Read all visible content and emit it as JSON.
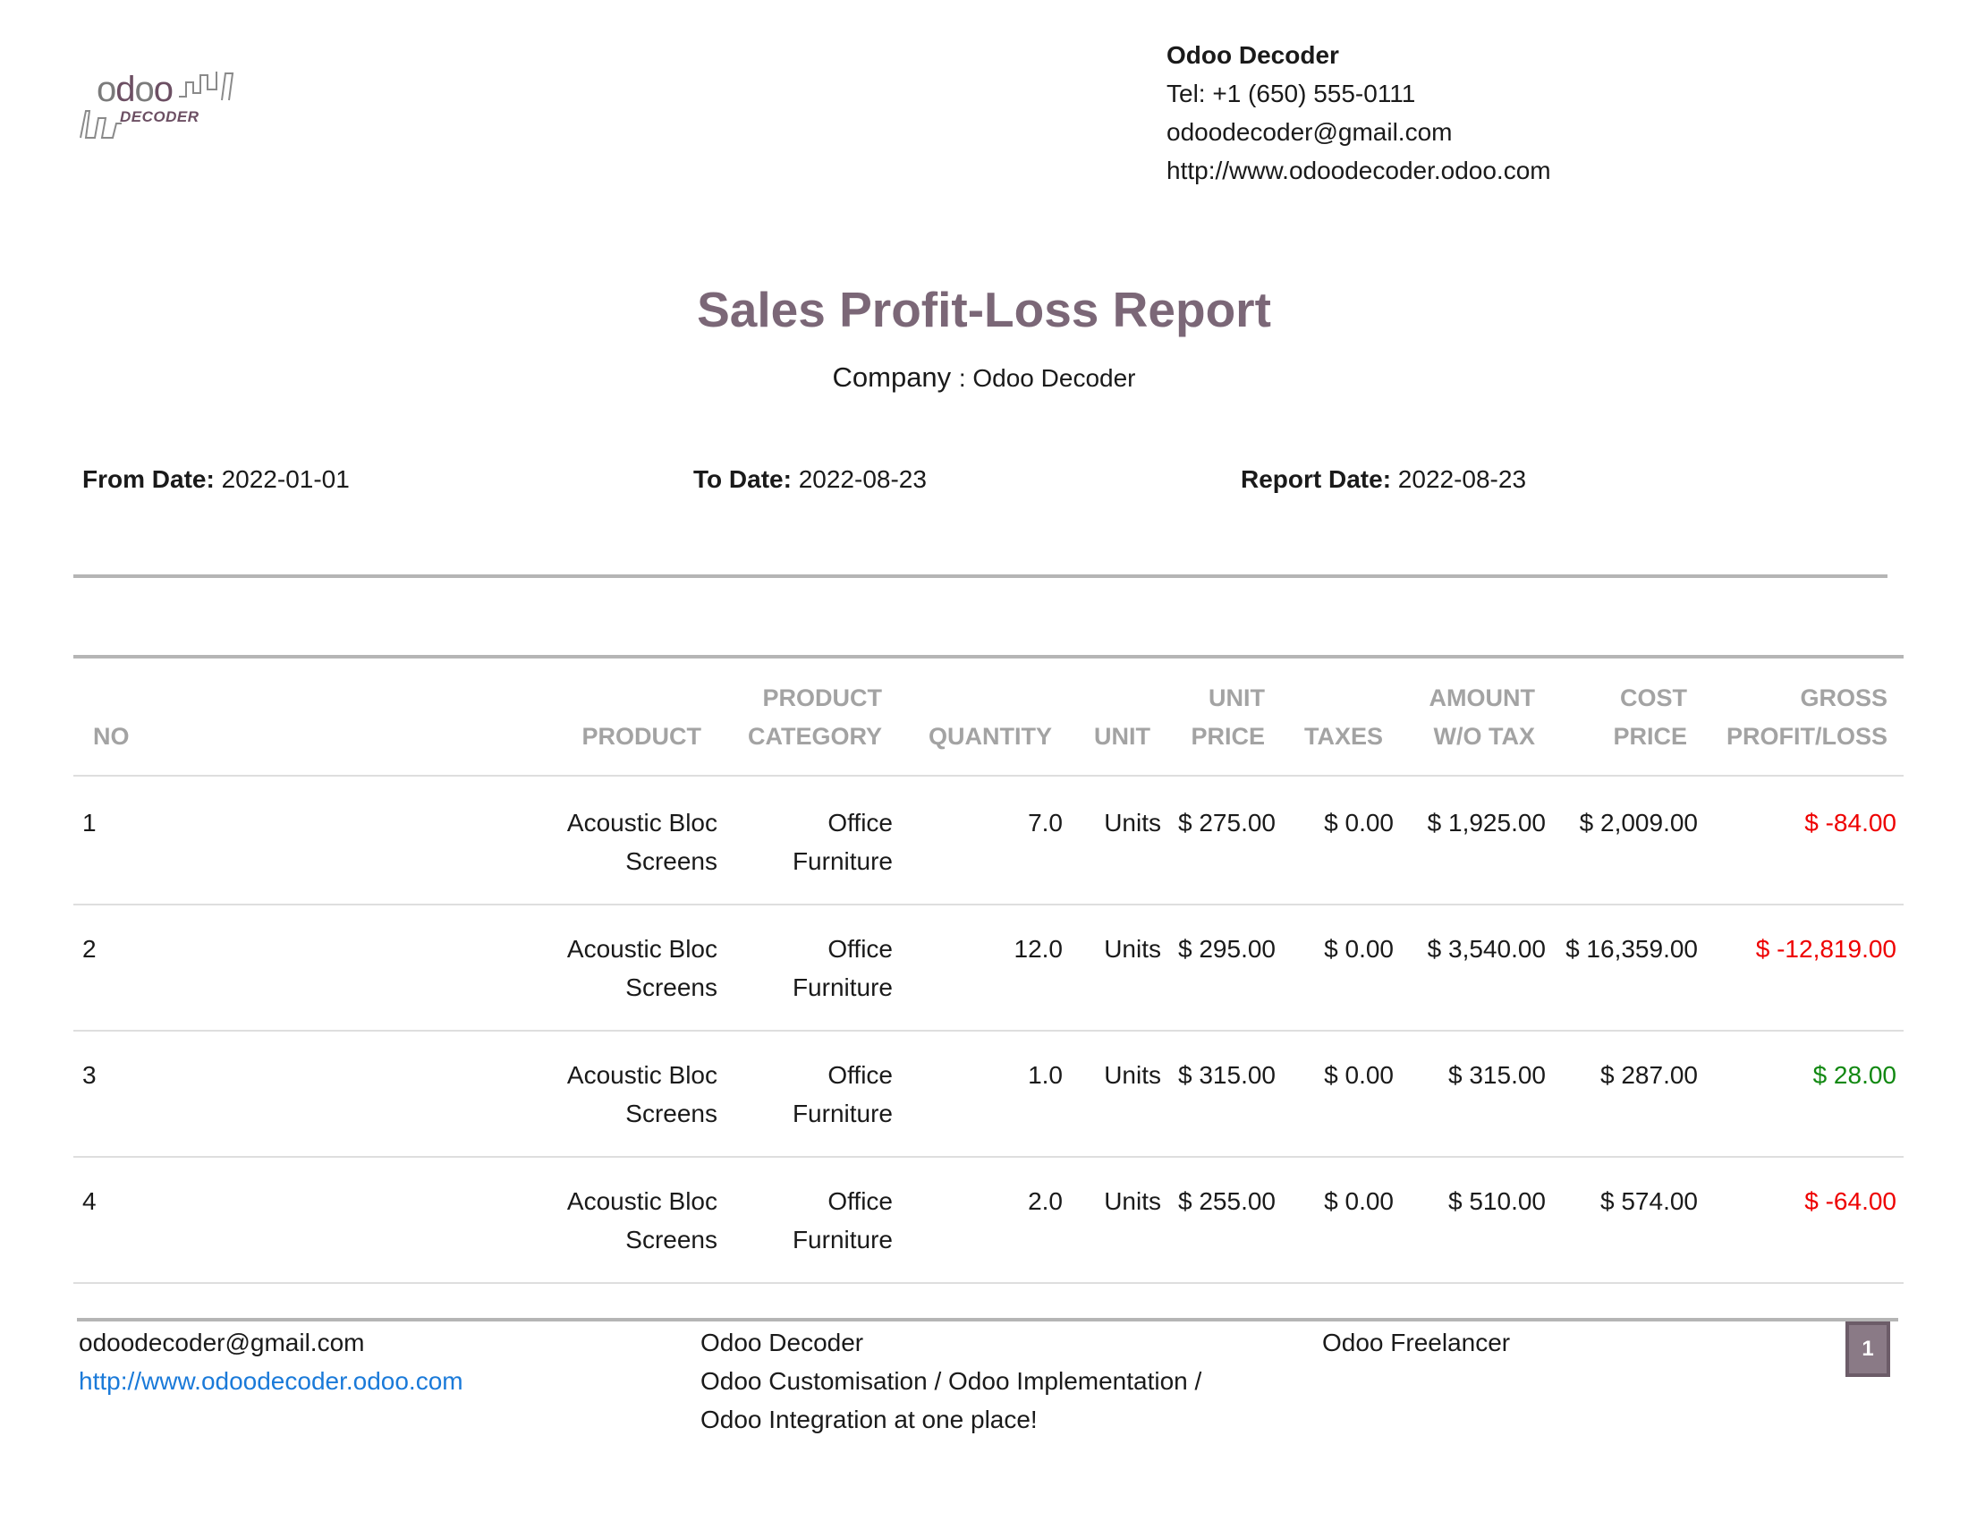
{
  "logo": {
    "wordmark": "odoo",
    "sub": "DECODER"
  },
  "company": {
    "name": "Odoo Decoder",
    "tel": "Tel: +1 (650) 555-0111",
    "email": "odoodecoder@gmail.com",
    "website": "http://www.odoodecoder.odoo.com"
  },
  "report": {
    "title": "Sales Profit-Loss Report",
    "company_label": "Company",
    "company_value": ": Odoo Decoder",
    "from_label": "From Date:",
    "from_value": "2022-01-01",
    "to_label": "To Date:",
    "to_value": "2022-08-23",
    "report_date_label": "Report Date:",
    "report_date_value": "2022-08-23"
  },
  "table": {
    "headers": {
      "no": "NO",
      "product": "PRODUCT",
      "category_1": "PRODUCT",
      "category_2": "CATEGORY",
      "quantity": "QUANTITY",
      "unit": "UNIT",
      "unit_price_1": "UNIT",
      "unit_price_2": "PRICE",
      "taxes": "TAXES",
      "amount_1": "AMOUNT",
      "amount_2": "W/O TAX",
      "cost_1": "COST",
      "cost_2": "PRICE",
      "gross_1": "GROSS",
      "gross_2": "PROFIT/LOSS"
    },
    "rows": [
      {
        "no": "1",
        "product_1": "Acoustic Bloc",
        "product_2": "Screens",
        "category_1": "Office",
        "category_2": "Furniture",
        "quantity": "7.0",
        "unit": "Units",
        "unit_price": "$ 275.00",
        "taxes": "$ 0.00",
        "amount": "$ 1,925.00",
        "cost": "$ 2,009.00",
        "gross": "$ -84.00",
        "gross_color": "#ee0000"
      },
      {
        "no": "2",
        "product_1": "Acoustic Bloc",
        "product_2": "Screens",
        "category_1": "Office",
        "category_2": "Furniture",
        "quantity": "12.0",
        "unit": "Units",
        "unit_price": "$ 295.00",
        "taxes": "$ 0.00",
        "amount": "$ 3,540.00",
        "cost": "$ 16,359.00",
        "gross": "$ -12,819.00",
        "gross_color": "#ee0000"
      },
      {
        "no": "3",
        "product_1": "Acoustic Bloc",
        "product_2": "Screens",
        "category_1": "Office",
        "category_2": "Furniture",
        "quantity": "1.0",
        "unit": "Units",
        "unit_price": "$ 315.00",
        "taxes": "$ 0.00",
        "amount": "$ 315.00",
        "cost": "$ 287.00",
        "gross": "$ 28.00",
        "gross_color": "#118811"
      },
      {
        "no": "4",
        "product_1": "Acoustic Bloc",
        "product_2": "Screens",
        "category_1": "Office",
        "category_2": "Furniture",
        "quantity": "2.0",
        "unit": "Units",
        "unit_price": "$ 255.00",
        "taxes": "$ 0.00",
        "amount": "$ 510.00",
        "cost": "$ 574.00",
        "gross": "$ -64.00",
        "gross_color": "#ee0000"
      }
    ]
  },
  "footer": {
    "email": "odoodecoder@gmail.com",
    "website": "http://www.odoodecoder.odoo.com",
    "company": "Odoo Decoder",
    "tagline_1": "Odoo Customisation / Odoo Implementation /",
    "tagline_2": "Odoo Integration at one place!",
    "role": "Odoo Freelancer",
    "page": "1"
  },
  "colors": {
    "title": "#7b6777",
    "negative": "#ee0000",
    "positive": "#118811",
    "link": "#1a7ad9",
    "header": "#a3a3a3"
  }
}
